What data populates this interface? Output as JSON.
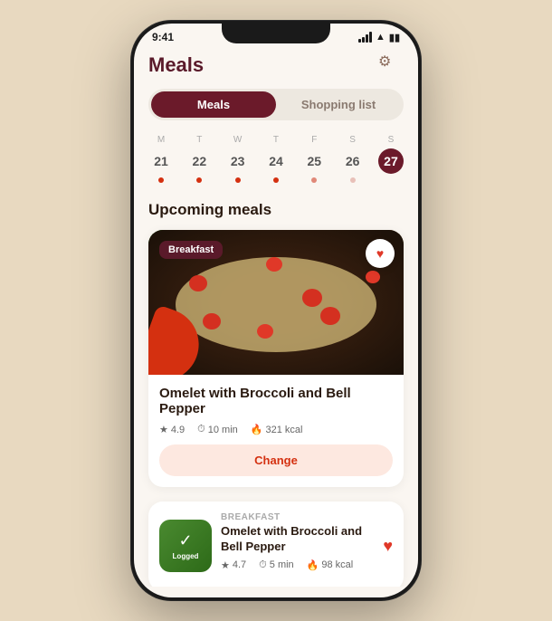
{
  "app": {
    "title": "Meals",
    "status_time": "9:41"
  },
  "tabs": {
    "active": "Meals",
    "inactive": "Shopping list"
  },
  "calendar": {
    "days": [
      {
        "label": "M",
        "num": "21",
        "dot_color": "#d43010",
        "active": false
      },
      {
        "label": "T",
        "num": "22",
        "dot_color": "#d43010",
        "active": false
      },
      {
        "label": "W",
        "num": "23",
        "dot_color": "#d43010",
        "active": false
      },
      {
        "label": "T",
        "num": "24",
        "dot_color": "#d43010",
        "active": false
      },
      {
        "label": "F",
        "num": "25",
        "dot_color": "#e08878",
        "active": false
      },
      {
        "label": "S",
        "num": "26",
        "dot_color": "#e08878",
        "active": false
      },
      {
        "label": "S",
        "num": "27",
        "dot_color": null,
        "active": true
      }
    ]
  },
  "section": {
    "upcoming_label": "Upcoming meals"
  },
  "main_meal": {
    "badge": "Breakfast",
    "name": "Omelet with Broccoli and Bell Pepper",
    "rating": "4.9",
    "time": "10 min",
    "calories": "321 kcal",
    "change_label": "Change"
  },
  "bottom_meal": {
    "category": "BREAKFAST",
    "name": "Omelet with Broccoli and Bell Pepper",
    "rating": "4.7",
    "time": "5 min",
    "calories": "98 kcal",
    "logged_label": "Logged",
    "check": "✓"
  },
  "icons": {
    "star": "★",
    "clock": "🕐",
    "flame": "🔥",
    "heart_outline": "♡",
    "heart_filled": "♥",
    "gear": "⚙"
  }
}
